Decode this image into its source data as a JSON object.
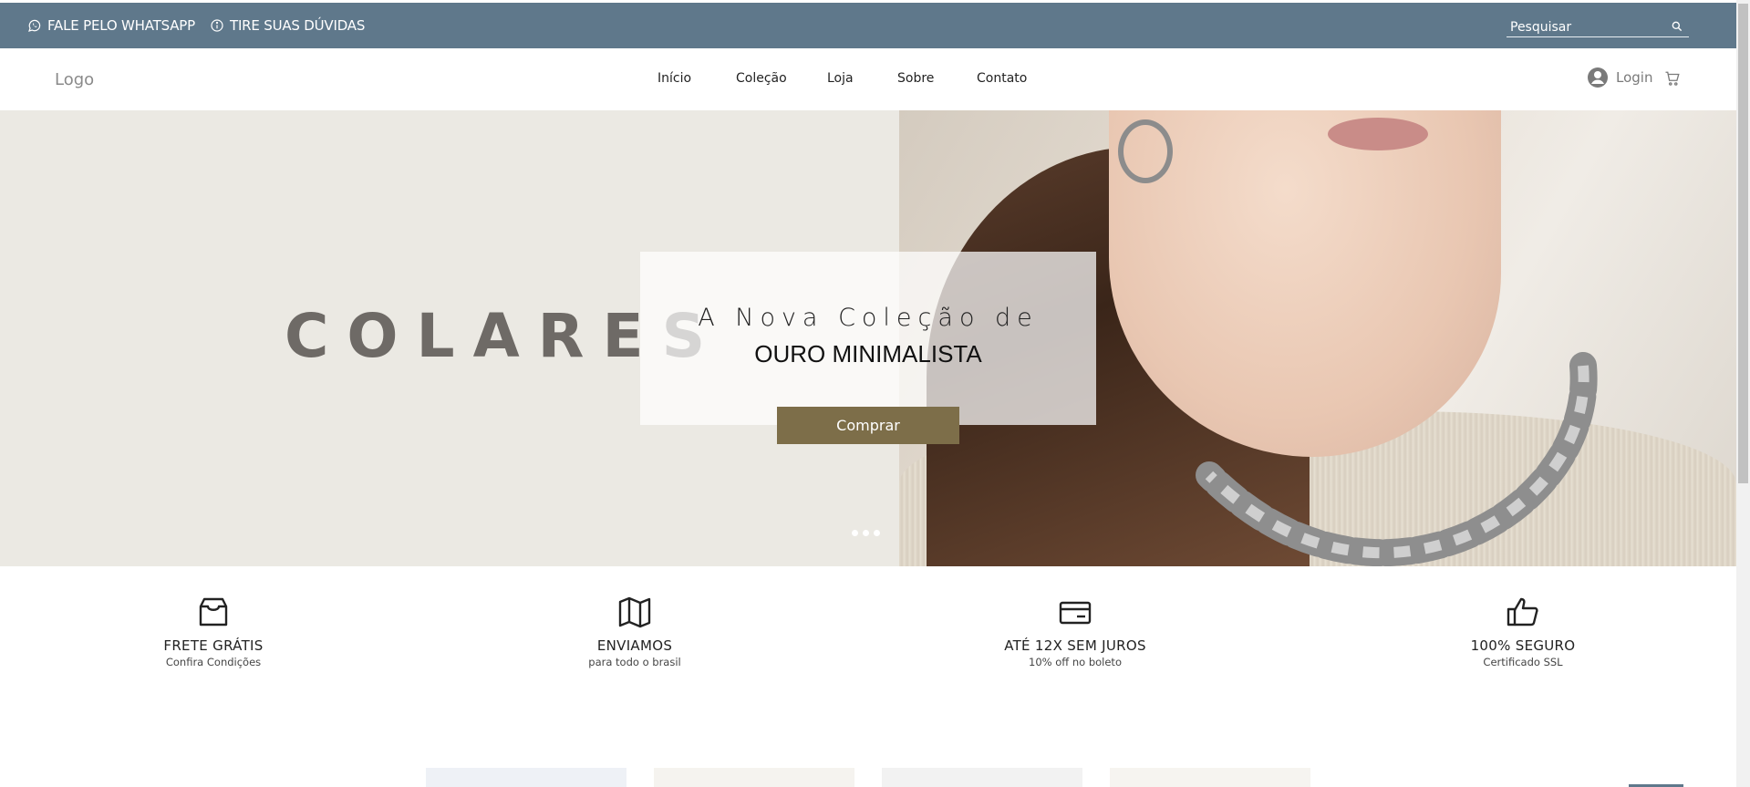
{
  "topbar": {
    "whatsapp_label": "FALE PELO WHATSAPP",
    "faq_label": "TIRE SUAS DÚVIDAS",
    "search_placeholder": "Pesquisar"
  },
  "header": {
    "logo": "Logo",
    "nav": [
      "Início",
      "Coleção",
      "Loja",
      "Sobre",
      "Contato"
    ],
    "login_label": "Login"
  },
  "hero": {
    "headline": "COLARES",
    "promo_line1": "A Nova Coleção de",
    "promo_line2": "OURO MINIMALISTA",
    "button_label": "Comprar",
    "slide_count": 3
  },
  "features": [
    {
      "icon": "inbox-icon",
      "title": "FRETE GRÁTIS",
      "subtitle": "Confira Condições"
    },
    {
      "icon": "map-icon",
      "title": "ENVIAMOS",
      "subtitle": "para todo o brasil"
    },
    {
      "icon": "credit-card-icon",
      "title": "ATÉ 12X SEM JUROS",
      "subtitle": "10% off no boleto"
    },
    {
      "icon": "thumbs-up-icon",
      "title": "100% SEGURO",
      "subtitle": "Certificado SSL"
    }
  ],
  "colors": {
    "topbar": "#5f788b",
    "accent": "#7d6e49",
    "hero_bg": "#ebe9e3"
  }
}
